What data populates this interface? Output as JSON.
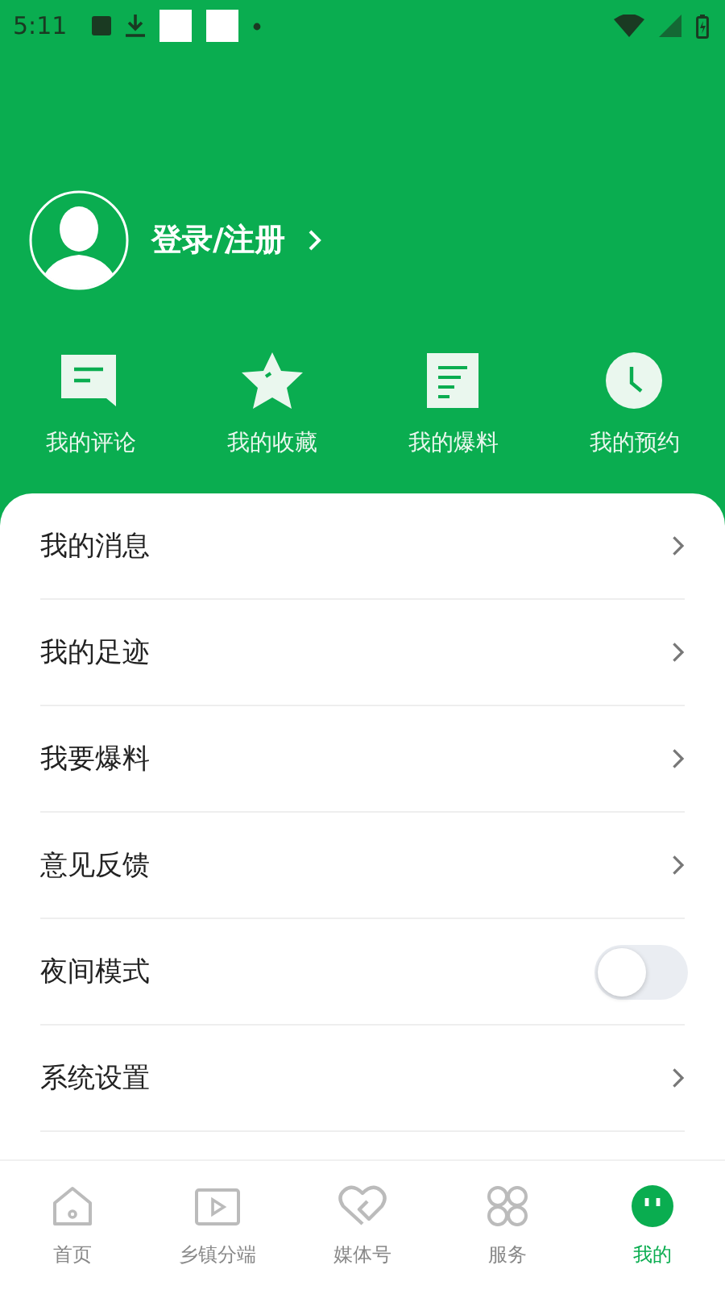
{
  "status_bar": {
    "time": "5:11"
  },
  "profile": {
    "login_label": "登录/注册"
  },
  "shortcuts": [
    {
      "label": "我的评论",
      "kind": "comment"
    },
    {
      "label": "我的收藏",
      "kind": "star"
    },
    {
      "label": "我的爆料",
      "kind": "doc"
    },
    {
      "label": "我的预约",
      "kind": "clock"
    }
  ],
  "menu": [
    {
      "label": "我的消息",
      "kind": "link"
    },
    {
      "label": "我的足迹",
      "kind": "link"
    },
    {
      "label": "我要爆料",
      "kind": "link"
    },
    {
      "label": "意见反馈",
      "kind": "link"
    },
    {
      "label": "夜间模式",
      "kind": "toggle",
      "on": false
    },
    {
      "label": "系统设置",
      "kind": "link"
    }
  ],
  "tabs": [
    {
      "label": "首页",
      "kind": "home",
      "selected": false
    },
    {
      "label": "乡镇分端",
      "kind": "play",
      "selected": false
    },
    {
      "label": "媒体号",
      "kind": "heart",
      "selected": false
    },
    {
      "label": "服务",
      "kind": "grid",
      "selected": false
    },
    {
      "label": "我的",
      "kind": "face",
      "selected": true
    }
  ]
}
